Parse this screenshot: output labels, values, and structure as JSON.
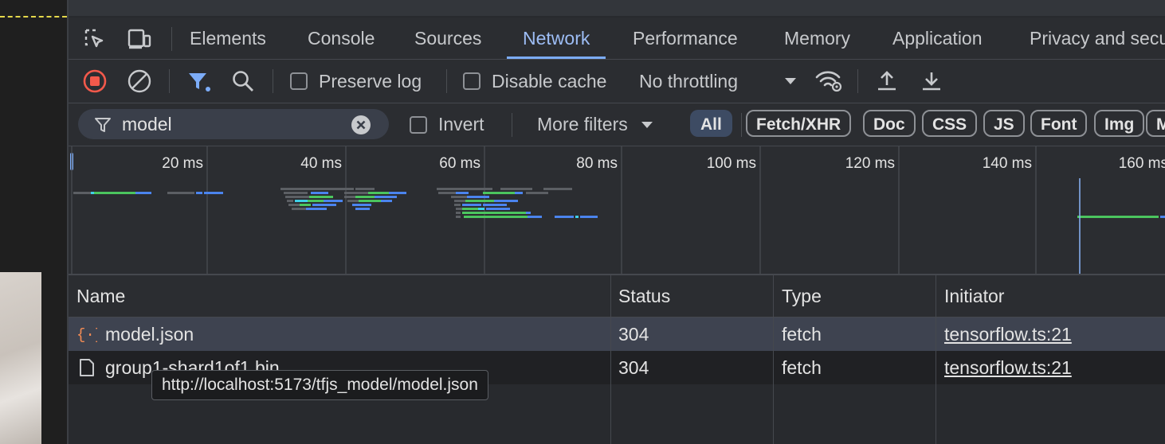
{
  "tabs": [
    {
      "label": "Elements"
    },
    {
      "label": "Console"
    },
    {
      "label": "Sources"
    },
    {
      "label": "Network"
    },
    {
      "label": "Performance"
    },
    {
      "label": "Memory"
    },
    {
      "label": "Application"
    },
    {
      "label": "Privacy and security"
    }
  ],
  "active_tab": "Network",
  "toolbar": {
    "preserve_log": "Preserve log",
    "disable_cache": "Disable cache",
    "throttling": "No throttling"
  },
  "filter": {
    "value": "model",
    "invert": "Invert",
    "more_filters": "More filters",
    "types": [
      "All",
      "Fetch/XHR",
      "Doc",
      "CSS",
      "JS",
      "Font",
      "Img",
      "Media"
    ],
    "active_type": "All"
  },
  "overview": {
    "ticks": [
      "20 ms",
      "40 ms",
      "60 ms",
      "80 ms",
      "100 ms",
      "120 ms",
      "140 ms",
      "160 ms"
    ]
  },
  "table": {
    "columns": [
      "Name",
      "Status",
      "Type",
      "Initiator"
    ],
    "rows": [
      {
        "name": "model.json",
        "status": "304",
        "type": "fetch",
        "initiator": "tensorflow.ts:21",
        "icon": "json-braces-icon"
      },
      {
        "name": "group1-shard1of1.bin",
        "status": "304",
        "type": "fetch",
        "initiator": "tensorflow.ts:21",
        "icon": "document-icon"
      }
    ]
  },
  "tooltip": "http://localhost:5173/tfjs_model/model.json",
  "colors": {
    "accent": "#7cacf8",
    "record": "#f2594b",
    "bar_green": "#4bc55e",
    "bar_blue": "#4b84ee",
    "bar_cyan": "#3fd0e8"
  }
}
